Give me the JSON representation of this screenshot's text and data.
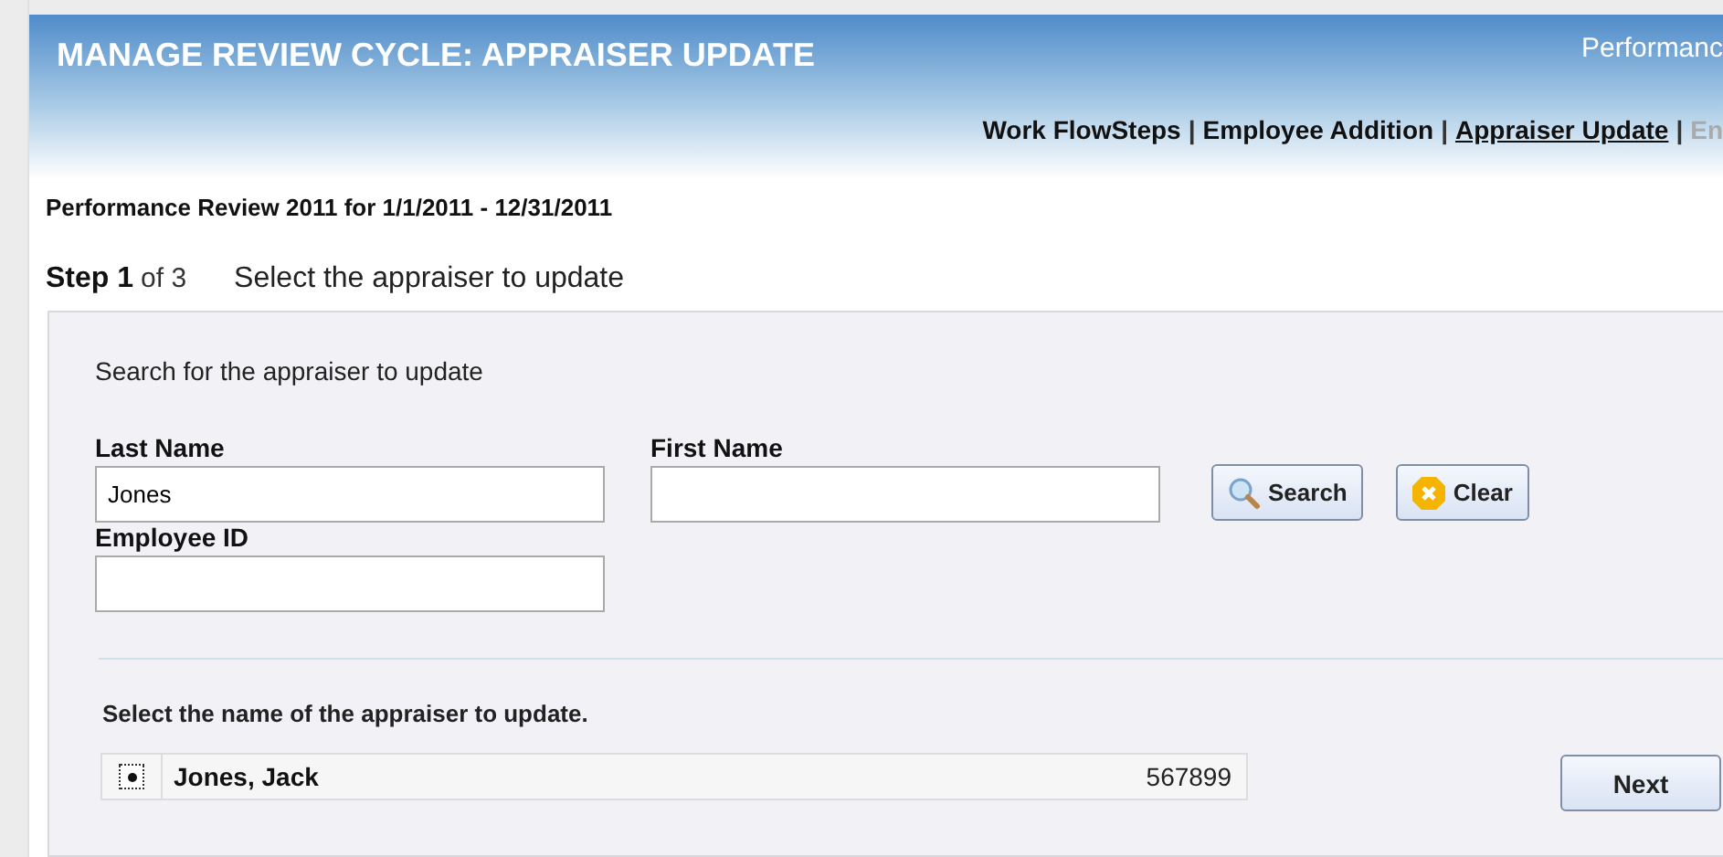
{
  "header": {
    "title": "MANAGE REVIEW CYCLE: APPRAISER UPDATE",
    "corner_text": "Performanc"
  },
  "nav": {
    "items": [
      {
        "label": "Work FlowSteps",
        "selected": false,
        "disabled": false,
        "separator": "|"
      },
      {
        "label": "Employee Addition",
        "selected": false,
        "disabled": false,
        "separator": "|"
      },
      {
        "label": "Appraiser Update",
        "selected": true,
        "disabled": false,
        "separator": "|"
      },
      {
        "label": "En",
        "selected": false,
        "disabled": true
      }
    ]
  },
  "review_title": "Performance Review 2011 for 1/1/2011 - 12/31/2011",
  "step": {
    "label": "Step 1",
    "of": "of 3",
    "instruction": "Select the appraiser to update"
  },
  "search": {
    "heading": "Search for the appraiser to update",
    "fields": [
      {
        "label": "Last Name",
        "value": "Jones"
      },
      {
        "label": "First Name"
      },
      {
        "label": "Employee ID"
      }
    ],
    "buttons": [
      {
        "kind": "search",
        "label": "Search"
      },
      {
        "kind": "clear",
        "label": "Clear"
      }
    ]
  },
  "results": {
    "heading": "Select the name of the appraiser to update.",
    "rows": [
      {
        "name": "Jones, Jack",
        "id": "567899",
        "selected": true
      }
    ]
  },
  "next_button": "Next"
}
